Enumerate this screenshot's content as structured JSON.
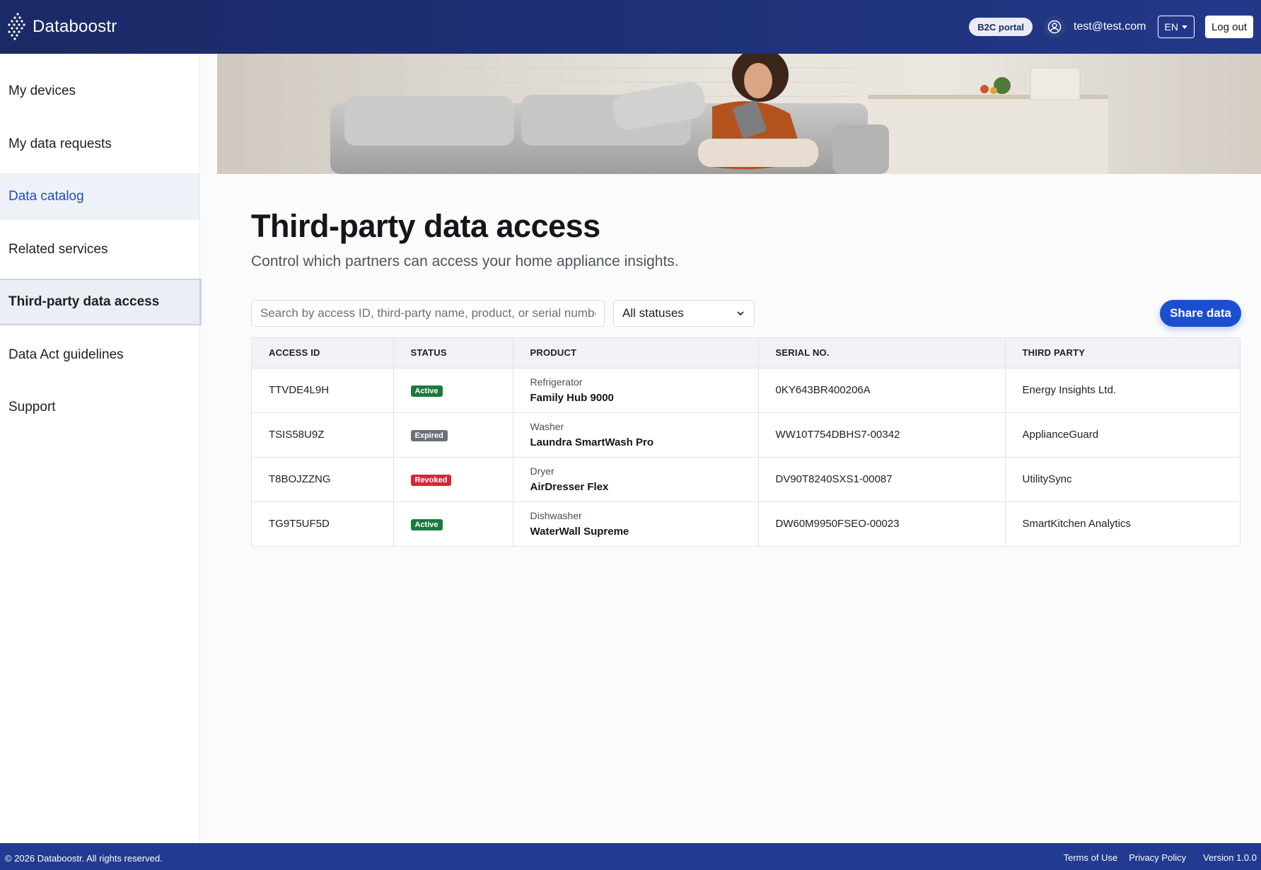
{
  "header": {
    "brand": "Databoostr",
    "portal_badge": "B2C portal",
    "user_email": "test@test.com",
    "language": "EN",
    "logout_label": "Log out"
  },
  "sidebar": {
    "items": [
      {
        "label": "My devices"
      },
      {
        "label": "My data requests"
      },
      {
        "label": "Data catalog"
      },
      {
        "label": "Related services"
      },
      {
        "label": "Third-party data access"
      },
      {
        "label": "Data Act guidelines"
      },
      {
        "label": "Support"
      }
    ],
    "active_item": "Third-party data access"
  },
  "main": {
    "title": "Third-party data access",
    "subtitle": "Control which partners can access your home appliance insights.",
    "search": {
      "placeholder": "Search by access ID, third-party name, product, or serial number",
      "value": ""
    },
    "status_filter": {
      "selected": "All statuses"
    },
    "share_label": "Share data",
    "table": {
      "columns": [
        "ACCESS ID",
        "STATUS",
        "PRODUCT",
        "SERIAL NO.",
        "THIRD PARTY"
      ],
      "rows": [
        {
          "access_id": "TTVDE4L9H",
          "status": "Active",
          "category": "Refrigerator",
          "product": "Family Hub 9000",
          "serial": "0KY643BR400206A",
          "third_party": "Energy Insights Ltd."
        },
        {
          "access_id": "TSIS58U9Z",
          "status": "Expired",
          "category": "Washer",
          "product": "Laundra SmartWash Pro",
          "serial": "WW10T754DBHS7-00342",
          "third_party": "ApplianceGuard"
        },
        {
          "access_id": "T8BOJZZNG",
          "status": "Revoked",
          "category": "Dryer",
          "product": "AirDresser Flex",
          "serial": "DV90T8240SXS1-00087",
          "third_party": "UtilitySync"
        },
        {
          "access_id": "TG9T5UF5D",
          "status": "Active",
          "category": "Dishwasher",
          "product": "WaterWall Supreme",
          "serial": "DW60M9950FSEO-00023",
          "third_party": "SmartKitchen Analytics"
        }
      ]
    }
  },
  "footer": {
    "copyright": "© 2026 Databoostr. All rights reserved.",
    "terms": "Terms of Use",
    "privacy": "Privacy Policy",
    "version": "Version 1.0.0"
  },
  "colors": {
    "header_bg": "#1e3177",
    "accent": "#1c4fd0",
    "active_badge": "#1a7a3e",
    "expired_badge": "#6b7079",
    "revoked_badge": "#d4283a",
    "footer_bg": "#223a8f"
  },
  "icons": {
    "brand": "dotted-arrow-logo",
    "user": "user-circle-icon",
    "select": "chevron-down-icon"
  }
}
